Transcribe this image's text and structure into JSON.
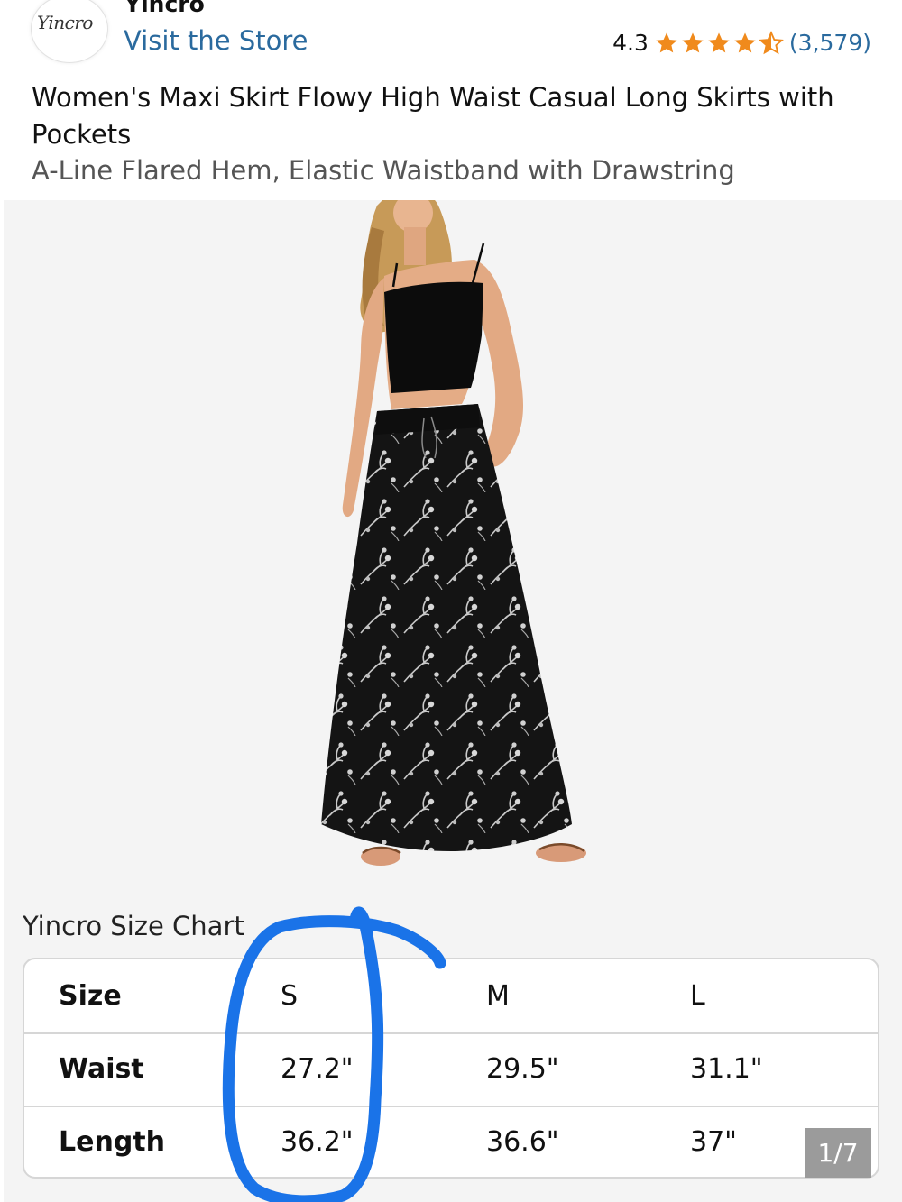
{
  "store": {
    "brand": "Yincro",
    "logo_text": "Yincro",
    "visit_label": "Visit the Store"
  },
  "rating": {
    "value": "4.3",
    "stars": 4.3,
    "count": "(3,579)",
    "star_color": "#f08a1c"
  },
  "product": {
    "title": "Women's Maxi Skirt Flowy High Waist Casual Long Skirts with Pockets",
    "subtitle": "A-Line Flared Hem, Elastic Waistband with Drawstring"
  },
  "gallery": {
    "image": "model-in-black-crop-top-and-black-floral-maxi-skirt",
    "counter": "1/7"
  },
  "size_chart": {
    "title": "Yincro Size Chart",
    "rows": [
      {
        "label": "Size",
        "values": [
          "S",
          "M",
          "L"
        ]
      },
      {
        "label": "Waist",
        "values": [
          "27.2\"",
          "29.5\"",
          "31.1\""
        ]
      },
      {
        "label": "Length",
        "values": [
          "36.2\"",
          "36.6\"",
          "37\""
        ]
      }
    ]
  },
  "annotation": {
    "color": "#1a73e8",
    "marks": "Column S circled"
  },
  "colors": {
    "link": "#2a6a9e",
    "gallery_bg": "#f4f4f4"
  }
}
